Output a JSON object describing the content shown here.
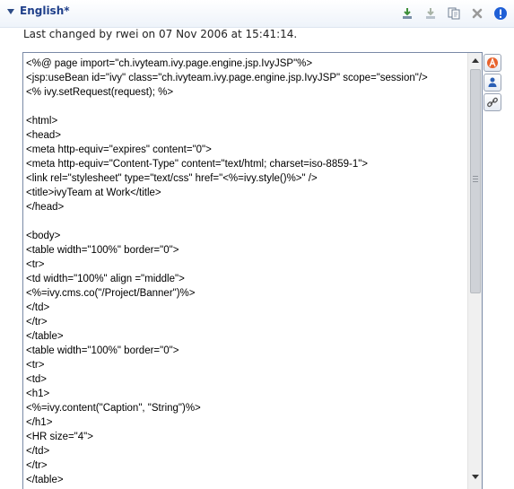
{
  "section": {
    "title": "English*",
    "last_changed": "Last changed by rwei on 07 Nov 2006 at 15:41:14."
  },
  "toolbar": {
    "icons": [
      "download-icon",
      "download-disabled-icon",
      "copy-icon",
      "delete-icon",
      "info-icon"
    ]
  },
  "side_tools": {
    "icons": [
      "text-style-icon",
      "users-icon",
      "link-icon"
    ]
  },
  "editor": {
    "lines": [
      "<%@ page import=\"ch.ivyteam.ivy.page.engine.jsp.IvyJSP\"%>",
      "<jsp:useBean id=\"ivy\" class=\"ch.ivyteam.ivy.page.engine.jsp.IvyJSP\" scope=\"session\"/>",
      "<% ivy.setRequest(request); %>",
      "",
      "<html>",
      "<head>",
      "<meta http-equiv=\"expires\" content=\"0\">",
      "<meta http-equiv=\"Content-Type\" content=\"text/html; charset=iso-8859-1\">",
      "<link rel=\"stylesheet\" type=\"text/css\" href=\"<%=ivy.style()%>\" />",
      "<title>ivyTeam at Work</title>",
      "</head>",
      "",
      "<body>",
      "<table width=\"100%\" border=\"0\">",
      "<tr>",
      "<td width=\"100%\" align =\"middle\">",
      "<%=ivy.cms.co(\"/Project/Banner\")%>",
      "</td>",
      "</tr>",
      "</table>",
      "<table width=\"100%\" border=\"0\">",
      "<tr>",
      "<td>",
      "<h1>",
      "<%=ivy.content(\"Caption\", \"String\")%>",
      "</h1>",
      "<HR size=\"4\">",
      "</td>",
      "</tr>",
      "</table>"
    ]
  }
}
